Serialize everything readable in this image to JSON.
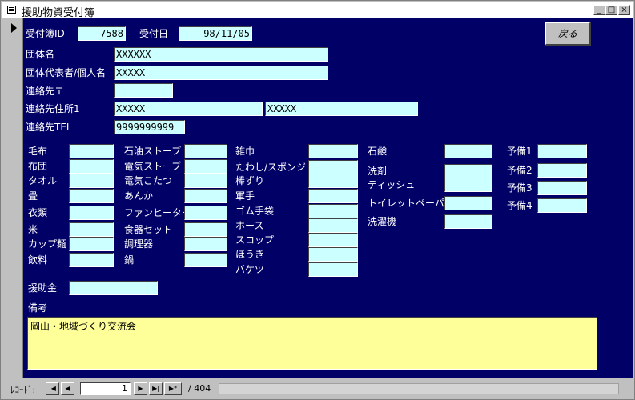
{
  "window": {
    "title": "援助物資受付簿"
  },
  "titlebar_buttons": {
    "minimize": "_",
    "maximize": "□",
    "close": "×"
  },
  "header": {
    "receipt_id_label": "受付簿ID",
    "receipt_id_value": "7588",
    "receipt_date_label": "受付日",
    "receipt_date_value": "98/11/05",
    "back_button": "戻る"
  },
  "contact": {
    "group_name_label": "団体名",
    "group_name_value": "XXXXXX",
    "representative_label": "団体代表者/個人名",
    "representative_value": "XXXXX",
    "postal_label": "連絡先〒",
    "postal_value": "",
    "address_label": "連絡先住所1",
    "address_value_1": "XXXXX",
    "address_value_2": "XXXXX",
    "tel_label": "連絡先TEL",
    "tel_value": "9999999999"
  },
  "items": {
    "col1": [
      "毛布",
      "布団",
      "タオル",
      "畳",
      "衣類",
      "米",
      "カップ麺",
      "飲料"
    ],
    "col2": [
      "石油ストーブ",
      "電気ストーブ",
      "電気こたつ",
      "あんか",
      "ファンヒーター",
      "食器セット",
      "調理器",
      "鍋"
    ],
    "col3": [
      "雑巾",
      "たわし/スポンジ",
      "棒ずり",
      "軍手",
      "ゴム手袋",
      "ホース",
      "スコップ",
      "ほうき",
      "バケツ"
    ],
    "col4": [
      "石鹸",
      "洗剤",
      "ティッシュ",
      "トイレットペーパー",
      "洗濯機"
    ],
    "col5": [
      "予備1",
      "予備2",
      "予備3",
      "予備4"
    ]
  },
  "donation": {
    "label": "援助金",
    "value": ""
  },
  "remarks": {
    "label": "備考",
    "value": "岡山・地域づくり交流会"
  },
  "navigation": {
    "record_label": "ﾚｺｰﾄﾞ:",
    "first": "|◀",
    "prev": "◀",
    "current": "1",
    "next": "▶",
    "last": "▶|",
    "new": "▶*",
    "total": "/ 404"
  },
  "colors": {
    "form_bg": "#000066",
    "field_bg": "#ccffff",
    "memo_bg": "#ffff99"
  }
}
